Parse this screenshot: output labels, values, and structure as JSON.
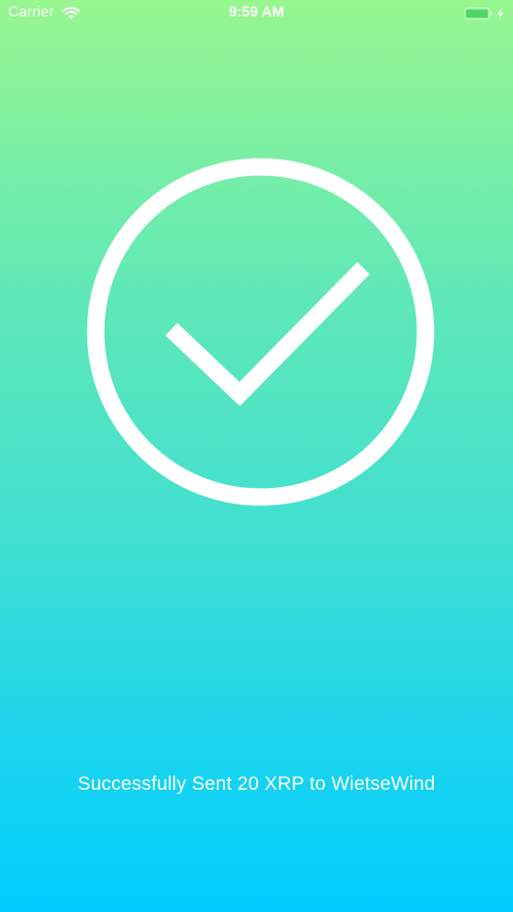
{
  "status_bar": {
    "carrier": "Carrier",
    "time": "9:59 AM",
    "icons": [
      "wifi-icon",
      "battery-charging-icon"
    ]
  },
  "success": {
    "icon": "checkmark-circle-icon",
    "message": "Successfully Sent 20 XRP to WietseWind"
  },
  "colors": {
    "gradient_top": "#97f78f",
    "gradient_bottom": "#00cdff",
    "foreground": "#ffffff",
    "battery_fill": "#4cd964"
  }
}
